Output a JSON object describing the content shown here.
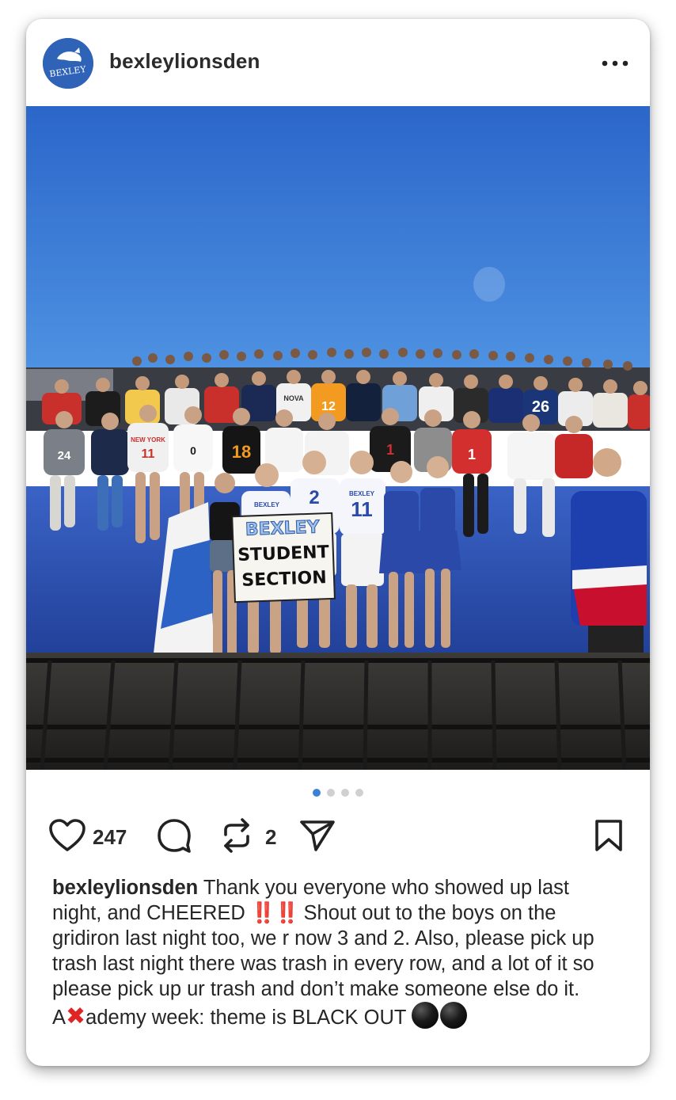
{
  "post": {
    "username": "bexleylionsden",
    "avatar_text": "BEXLEY",
    "likes": "247",
    "reposts": "2",
    "carousel": {
      "total": 4,
      "active": 1
    },
    "caption": {
      "username": "bexleylionsden",
      "part1": "Thank you everyone who showed up last night, and CHEERED",
      "bangs": "‼️‼️",
      "part2": "Shout out to the boys on the gridiron last night too, we r now 3 and 2. Also, please pick up trash last night there was trash in every row, and a lot of it so please pick up ur trash and don’t make someone else do it.  A",
      "x_emoji": "✖",
      "part3": "ademy week: theme is BLACK OUT"
    },
    "photo": {
      "sign_line1": "BEXLEY",
      "sign_line2": "STUDENT",
      "sign_line3": "SECTION",
      "jersey_numbers": [
        "24",
        "11",
        "0",
        "18",
        "12",
        "26",
        "1",
        "1",
        "2",
        "11"
      ],
      "jersey_text": [
        "NEW YORK",
        "NOVA",
        "BEXLEY",
        "BEXLEY"
      ]
    },
    "colors": {
      "sky_top": "#2f6fd0",
      "sky_bottom": "#4c8fe0",
      "wall_blue": "#2e55b8",
      "accent_red": "#e02424",
      "dot_active": "#3b82d6"
    },
    "icons": [
      "more-icon",
      "heart-icon",
      "comment-icon",
      "repost-icon",
      "share-icon",
      "bookmark-icon"
    ]
  }
}
